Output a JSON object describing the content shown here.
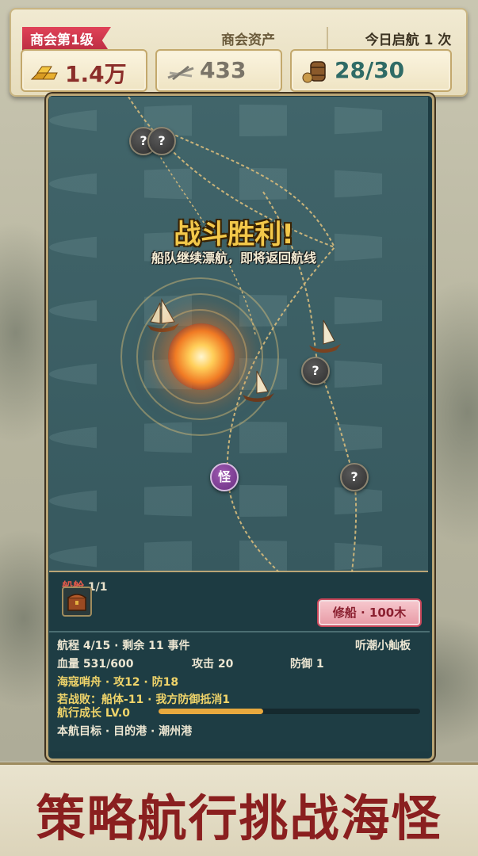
{
  "topbar": {
    "guild_level": "商会第1级",
    "assets_title": "商会资产",
    "sail_count": "今日启航 1 次",
    "gold": "1.4万",
    "wood": "433",
    "cargo": "28/30"
  },
  "map": {
    "victory_title": "战斗胜利!",
    "victory_subtitle": "船队继续漂航，即将返回航线",
    "unknown_node_label": "?",
    "monster_node_label": "怪"
  },
  "hold": {
    "label": "船舱",
    "count": "1/1"
  },
  "repair_button": "修船 · 100木",
  "info": {
    "voyage": "航程 4/15 · 剩余 11 事件",
    "ship_name": "听潮小舢板",
    "hp": "血量 531/600",
    "attack": "攻击 20",
    "defense": "防御 1",
    "enemy": "海寇哨舟 · 攻12 · 防18",
    "fail_text": "若战败：船体-11 · 我方防御抵消1",
    "growth": "航行成长 LV.0",
    "growth_progress": 0.4,
    "goal": "本航目标 · 目的港 · 潮州港"
  },
  "banner": "策略航行挑战海怪",
  "colors": {
    "accent_red": "#8a1f1f",
    "sea": "#3b5e63",
    "progress": "#e8a93e"
  }
}
